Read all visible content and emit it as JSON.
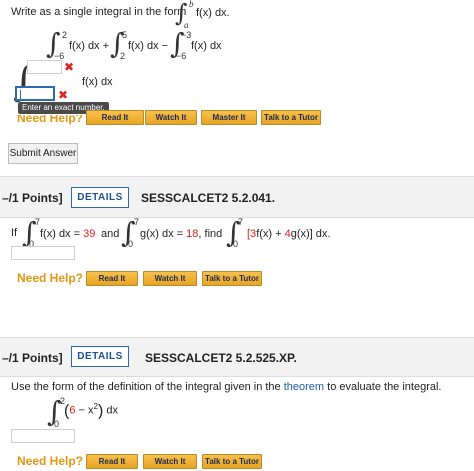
{
  "q1": {
    "instruction": "Write as a single integral in the form",
    "form_integrand": "f(x) dx.",
    "form_upper": "b",
    "form_lower": "a",
    "term1": {
      "upper": "2",
      "lower": "−6",
      "integrand": "f(x) dx +"
    },
    "term2": {
      "upper": "5",
      "lower": "2",
      "integrand": "f(x) dx −"
    },
    "term3": {
      "upper": "−3",
      "lower": "−6",
      "integrand": "f(x) dx"
    },
    "answer_integrand": "f(x) dx",
    "tooltip": "Enter an exact number.",
    "need_help": "Need Help?",
    "buttons": [
      "Read It",
      "Watch It",
      "Master It",
      "Talk to a Tutor"
    ],
    "submit": "Submit Answer"
  },
  "q2": {
    "points": "–/1 Points]",
    "details": "DETAILS",
    "question_id": "SESSCALCET2 5.2.041.",
    "if_label": "If",
    "int1": {
      "upper": "7",
      "lower": "0",
      "text": "f(x) dx = ",
      "value": "39"
    },
    "and_label": "and",
    "int2": {
      "upper": "7",
      "lower": "0",
      "text": "g(x) dx = ",
      "value": "18"
    },
    "find_label": ", find",
    "int3": {
      "upper": "7",
      "lower": "0",
      "text_a": "[3",
      "text_b": "f(x) + ",
      "text_c": "4",
      "text_d": "g(x)] dx."
    },
    "comma": ",",
    "need_help": "Need Help?",
    "buttons": [
      "Read It",
      "Watch It",
      "Talk to a Tutor"
    ]
  },
  "q3": {
    "points": "–/1 Points]",
    "details": "DETAILS",
    "question_id": "SESSCALCET2 5.2.525.XP.",
    "instruction_a": "Use the form of the definition of the integral given in the ",
    "theorem_link": "theorem",
    "instruction_b": " to evaluate the integral.",
    "integral": {
      "upper": "2",
      "lower": "0",
      "lparen": "(",
      "expr_a": "6",
      "expr_b": " − x",
      "sup": "2",
      "rparen": ")",
      "dx": "dx"
    },
    "need_help": "Need Help?",
    "buttons": [
      "Read It",
      "Watch It",
      "Talk to a Tutor"
    ]
  },
  "colors": {
    "accent_red": "#e0201e",
    "button_gold": "#f0b233",
    "link_blue": "#1e5aa8",
    "need_help_orange": "#e19614"
  }
}
